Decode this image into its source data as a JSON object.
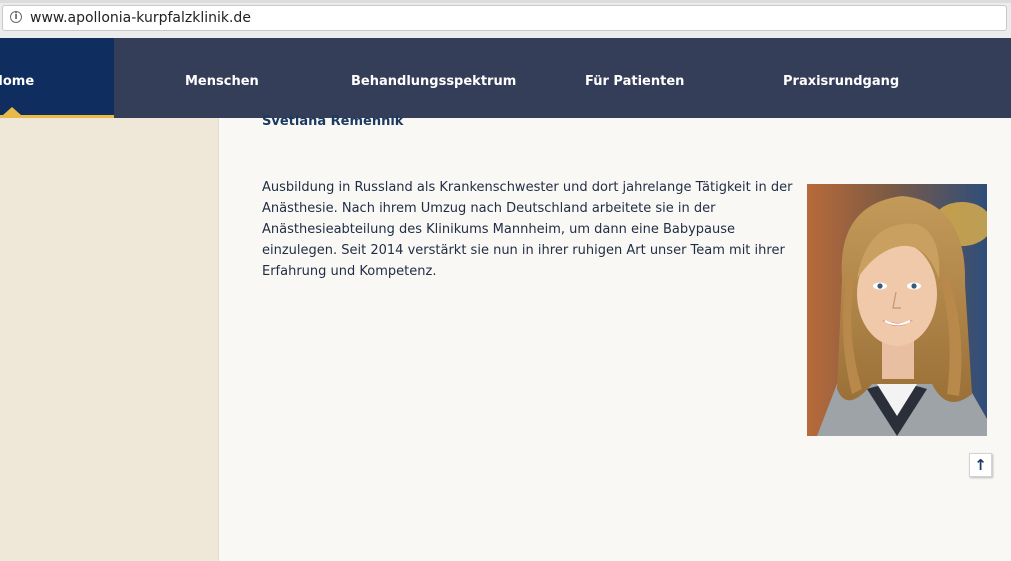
{
  "browser": {
    "url": "www.apollonia-kurpfalzklinik.de",
    "info_icon": "info-icon"
  },
  "nav": {
    "items": [
      {
        "label": "Home",
        "active": true
      },
      {
        "label": "Menschen"
      },
      {
        "label": "Behandlungsspektrum"
      },
      {
        "label": "Für Patienten"
      },
      {
        "label": "Praxisrundgang"
      }
    ]
  },
  "colors": {
    "nav_bg": "#353e58",
    "nav_active_bg": "#0f2d5e",
    "accent": "#e9b94a",
    "text": "#1f2d45"
  },
  "person": {
    "name": "Svetlana Remennik",
    "bio": "Ausbildung in Russland als Krankenschwester und dort jahrelange Tätigkeit in der Anästhesie. Nach ihrem Umzug nach Deutschland arbeitete sie in der Anästhesieabteilung des Klinikums Mannheim, um dann eine Babypause einzulegen. Seit 2014 verstärkt sie nun in ihrer ruhigen Art unser Team mit ihrer Erfahrung und Kompetenz."
  },
  "back_to_top": {
    "icon": "arrow-up-icon",
    "glyph": "↑"
  }
}
